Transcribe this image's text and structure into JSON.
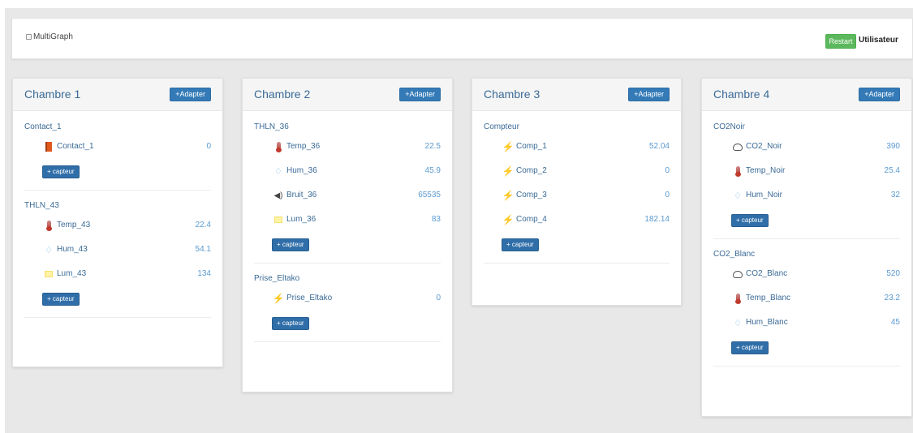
{
  "topbar": {
    "multigraph_label": "MultiGraph",
    "restart_label": "Restart",
    "user_label": "Utilisateur"
  },
  "rooms": [
    {
      "title": "Chambre 1",
      "adapter": "+Adapter",
      "groups": [
        {
          "title": "Contact_1",
          "capteur": "+ capteur",
          "sensors": [
            {
              "icon": "door-icon",
              "name": "Contact_1",
              "value": "0"
            }
          ]
        },
        {
          "title": "THLN_43",
          "capteur": "+ capteur",
          "sensors": [
            {
              "icon": "thermometer-icon",
              "name": "Temp_43",
              "value": "22.4"
            },
            {
              "icon": "water-drop-icon",
              "name": "Hum_43",
              "value": "54.1"
            },
            {
              "icon": "light-icon",
              "name": "Lum_43",
              "value": "134"
            }
          ]
        }
      ]
    },
    {
      "title": "Chambre 2",
      "adapter": "+Adapter",
      "groups": [
        {
          "title": "THLN_36",
          "capteur": "+ capteur",
          "sensors": [
            {
              "icon": "thermometer-icon",
              "name": "Temp_36",
              "value": "22.5"
            },
            {
              "icon": "water-drop-icon",
              "name": "Hum_36",
              "value": "45.9"
            },
            {
              "icon": "speaker-icon",
              "name": "Bruit_36",
              "value": "65535"
            },
            {
              "icon": "light-icon",
              "name": "Lum_36",
              "value": "83"
            }
          ]
        },
        {
          "title": "Prise_Eltako",
          "capteur": "+ capteur",
          "sensors": [
            {
              "icon": "bolt-icon",
              "name": "Prise_Eltako",
              "value": "0"
            }
          ]
        }
      ]
    },
    {
      "title": "Chambre 3",
      "adapter": "+Adapter",
      "groups": [
        {
          "title": "Compteur",
          "capteur": "+ capteur",
          "sensors": [
            {
              "icon": "bolt-icon",
              "name": "Comp_1",
              "value": "52.04"
            },
            {
              "icon": "bolt-icon",
              "name": "Comp_2",
              "value": "0"
            },
            {
              "icon": "bolt-icon",
              "name": "Comp_3",
              "value": "0"
            },
            {
              "icon": "bolt-icon",
              "name": "Comp_4",
              "value": "182.14"
            }
          ]
        }
      ]
    },
    {
      "title": "Chambre 4",
      "adapter": "+Adapter",
      "groups": [
        {
          "title": "CO2Noir",
          "capteur": "+ capteur",
          "sensors": [
            {
              "icon": "cloud-icon",
              "name": "CO2_Noir",
              "value": "390"
            },
            {
              "icon": "thermometer-icon",
              "name": "Temp_Noir",
              "value": "25.4"
            },
            {
              "icon": "water-drop-icon",
              "name": "Hum_Noir",
              "value": "32"
            }
          ]
        },
        {
          "title": "CO2_Blanc",
          "capteur": "+ capteur",
          "sensors": [
            {
              "icon": "cloud-icon",
              "name": "CO2_Blanc",
              "value": "520"
            },
            {
              "icon": "thermometer-icon",
              "name": "Temp_Blanc",
              "value": "23.2"
            },
            {
              "icon": "water-drop-icon",
              "name": "Hum_Blanc",
              "value": "45"
            }
          ]
        }
      ]
    }
  ]
}
